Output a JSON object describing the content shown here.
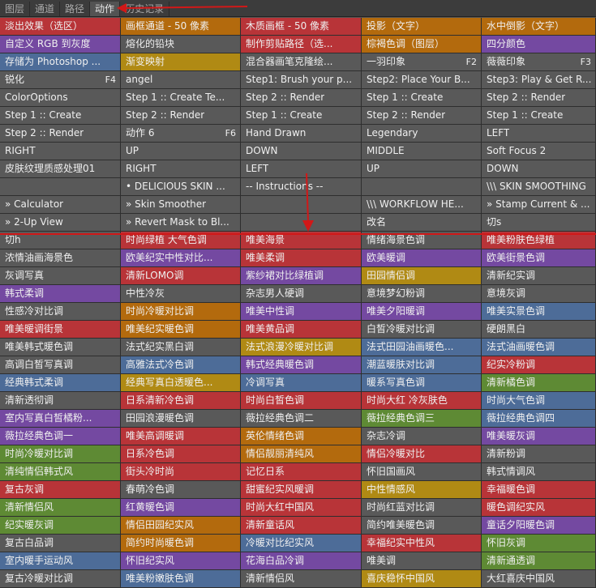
{
  "tabs": [
    {
      "label": "图层",
      "active": false
    },
    {
      "label": "通道",
      "active": false
    },
    {
      "label": "路径",
      "active": false
    },
    {
      "label": "动作",
      "active": true
    },
    {
      "label": "历史记录",
      "active": false
    }
  ],
  "palette": {
    "gray": "#595959",
    "orange": "#b36a0d",
    "purple": "#7449a1",
    "red": "#b83438",
    "gold": "#b08a14",
    "blue": "#4d6c98",
    "green": "#5e8a34"
  },
  "annotation_color": "#d11818",
  "rows": [
    [
      {
        "t": "淡出效果（选区）",
        "c": "red"
      },
      {
        "t": "画框通道 - 50 像素",
        "c": "orange"
      },
      {
        "t": "木质画框 - 50 像素",
        "c": "red"
      },
      {
        "t": "投影（文字）",
        "c": "orange"
      },
      {
        "t": "水中倒影（文字）",
        "c": "orange"
      }
    ],
    [
      {
        "t": "自定义 RGB 到灰度",
        "c": "purple"
      },
      {
        "t": "熔化的铅块",
        "c": "gray"
      },
      {
        "t": "制作剪贴路径（选...",
        "c": "red"
      },
      {
        "t": "棕褐色调（图层）",
        "c": "orange"
      },
      {
        "t": "四分颜色",
        "c": "purple"
      }
    ],
    [
      {
        "t": "存储为 Photoshop ...",
        "c": "blue"
      },
      {
        "t": "渐变映射",
        "c": "gold"
      },
      {
        "t": "混合器画笔克隆绘...",
        "c": "gray"
      },
      {
        "t": "一羽印象",
        "c": "gray",
        "k": "F2"
      },
      {
        "t": "薇薇印象",
        "c": "gray",
        "k": "F3"
      }
    ],
    [
      {
        "t": "锐化",
        "c": "gray",
        "k": "F4"
      },
      {
        "t": "angel",
        "c": "gray"
      },
      {
        "t": "Step1: Brush your p...",
        "c": "gray"
      },
      {
        "t": "Step2: Place Your B...",
        "c": "gray"
      },
      {
        "t": "Step3: Play & Get R...",
        "c": "gray"
      }
    ],
    [
      {
        "t": "ColorOptions",
        "c": "gray"
      },
      {
        "t": "Step 1 :: Create Te...",
        "c": "gray"
      },
      {
        "t": "Step 2 :: Render",
        "c": "gray"
      },
      {
        "t": "Step 1 :: Create",
        "c": "gray"
      },
      {
        "t": "Step 2 :: Render",
        "c": "gray"
      }
    ],
    [
      {
        "t": "Step 1 :: Create",
        "c": "gray"
      },
      {
        "t": "Step 2 :: Render",
        "c": "gray"
      },
      {
        "t": "Step 1 :: Create",
        "c": "gray"
      },
      {
        "t": "Step 2 :: Render",
        "c": "gray"
      },
      {
        "t": "Step 1 :: Create",
        "c": "gray"
      }
    ],
    [
      {
        "t": "Step 2 :: Render",
        "c": "gray"
      },
      {
        "t": "动作 6",
        "c": "gray",
        "k": "F6"
      },
      {
        "t": "Hand Drawn",
        "c": "gray"
      },
      {
        "t": "Legendary",
        "c": "gray"
      },
      {
        "t": "LEFT",
        "c": "gray"
      }
    ],
    [
      {
        "t": "RIGHT",
        "c": "gray"
      },
      {
        "t": "UP",
        "c": "gray"
      },
      {
        "t": "DOWN",
        "c": "gray"
      },
      {
        "t": "MIDDLE",
        "c": "gray"
      },
      {
        "t": "Soft Focus 2",
        "c": "gray"
      }
    ],
    [
      {
        "t": "皮肤纹理质感处理01",
        "c": "gray"
      },
      {
        "t": "RIGHT",
        "c": "gray"
      },
      {
        "t": "LEFT",
        "c": "gray"
      },
      {
        "t": "UP",
        "c": "gray"
      },
      {
        "t": "DOWN",
        "c": "gray"
      }
    ],
    [
      {
        "t": "",
        "c": "gray"
      },
      {
        "t": "• DELICIOUS SKIN ...",
        "c": "gray"
      },
      {
        "t": "-- Instructions --",
        "c": "gray"
      },
      {
        "t": "",
        "c": "gray"
      },
      {
        "t": "\\\\\\ SKIN SMOOTHING",
        "c": "gray"
      }
    ],
    [
      {
        "t": "» Calculator",
        "c": "gray"
      },
      {
        "t": "» Skin Smoother",
        "c": "gray"
      },
      {
        "t": "",
        "c": "gray"
      },
      {
        "t": "\\\\\\ WORKFLOW HE...",
        "c": "gray"
      },
      {
        "t": "» Stamp Current & ...",
        "c": "gray"
      }
    ],
    [
      {
        "t": "» 2-Up View",
        "c": "gray"
      },
      {
        "t": "» Revert Mask to Bl...",
        "c": "gray"
      },
      {
        "t": "",
        "c": "gray"
      },
      {
        "t": "改名",
        "c": "gray"
      },
      {
        "t": "切s",
        "c": "gray"
      }
    ],
    [
      {
        "t": "切h",
        "c": "gray"
      },
      {
        "t": "时尚绿植 大气色调",
        "c": "red"
      },
      {
        "t": "唯美海景",
        "c": "red"
      },
      {
        "t": "情绪海景色调",
        "c": "gray"
      },
      {
        "t": "唯美粉肤色绿植",
        "c": "red"
      }
    ],
    [
      {
        "t": "浓情油画海景色",
        "c": "gray"
      },
      {
        "t": "欧美纪实中性对比...",
        "c": "purple"
      },
      {
        "t": "唯美柔调",
        "c": "red"
      },
      {
        "t": "欧美暖调",
        "c": "purple"
      },
      {
        "t": "欧美街景色调",
        "c": "purple"
      }
    ],
    [
      {
        "t": "灰调写真",
        "c": "gray"
      },
      {
        "t": "清新LOMO调",
        "c": "red"
      },
      {
        "t": "紫纱裙对比绿植调",
        "c": "purple"
      },
      {
        "t": "田园情侣调",
        "c": "gold"
      },
      {
        "t": "清新纪实调",
        "c": "gray"
      }
    ],
    [
      {
        "t": "韩式柔调",
        "c": "purple"
      },
      {
        "t": "中性冷灰",
        "c": "gray"
      },
      {
        "t": "杂志男人硬调",
        "c": "gray"
      },
      {
        "t": "意境梦幻粉调",
        "c": "gray"
      },
      {
        "t": "意境灰调",
        "c": "gray"
      }
    ],
    [
      {
        "t": "性感冷对比调",
        "c": "gray"
      },
      {
        "t": "时尚冷暖对比调",
        "c": "orange"
      },
      {
        "t": "唯美中性调",
        "c": "purple"
      },
      {
        "t": "唯美夕阳暖调",
        "c": "purple"
      },
      {
        "t": "唯美实景色调",
        "c": "blue"
      }
    ],
    [
      {
        "t": "唯美暖调街景",
        "c": "red"
      },
      {
        "t": "唯美纪实暖色调",
        "c": "orange"
      },
      {
        "t": "唯美黄品调",
        "c": "red"
      },
      {
        "t": "白皙冷暖对比调",
        "c": "gray"
      },
      {
        "t": "硬朗黑白",
        "c": "gray"
      }
    ],
    [
      {
        "t": "唯美韩式暖色调",
        "c": "gray"
      },
      {
        "t": "法式纪实黑白调",
        "c": "gray"
      },
      {
        "t": "法式浪漫冷暖对比调",
        "c": "gold"
      },
      {
        "t": "法式田园油画暖色...",
        "c": "blue"
      },
      {
        "t": "法式油画暖色调",
        "c": "blue"
      }
    ],
    [
      {
        "t": "高调白皙写真调",
        "c": "gray"
      },
      {
        "t": "高雅法式冷色调",
        "c": "blue"
      },
      {
        "t": "韩式经典暖色调",
        "c": "purple"
      },
      {
        "t": "潮蓝暖肤对比调",
        "c": "blue"
      },
      {
        "t": "纪实冷粉调",
        "c": "red"
      }
    ],
    [
      {
        "t": "经典韩式柔调",
        "c": "blue"
      },
      {
        "t": "经典写真白透暖色...",
        "c": "gold"
      },
      {
        "t": "冷调写真",
        "c": "blue"
      },
      {
        "t": "暖系写真色调",
        "c": "blue"
      },
      {
        "t": "清新橘色调",
        "c": "green"
      }
    ],
    [
      {
        "t": "清新透彻调",
        "c": "gray"
      },
      {
        "t": "日系清新冷色调",
        "c": "red"
      },
      {
        "t": "时尚白皙色调",
        "c": "red"
      },
      {
        "t": "时尚大红 冷灰肤色",
        "c": "red"
      },
      {
        "t": "时尚大气色调",
        "c": "blue"
      }
    ],
    [
      {
        "t": "室内写真白皙橘粉...",
        "c": "purple"
      },
      {
        "t": "田园浪漫暖色调",
        "c": "gray"
      },
      {
        "t": "薇拉经典色调二",
        "c": "gray"
      },
      {
        "t": "薇拉经典色调三",
        "c": "green"
      },
      {
        "t": "薇拉经典色调四",
        "c": "blue"
      }
    ],
    [
      {
        "t": "薇拉经典色调一",
        "c": "purple"
      },
      {
        "t": "唯美高调暖调",
        "c": "red"
      },
      {
        "t": "英伦情绪色调",
        "c": "orange"
      },
      {
        "t": "杂志冷调",
        "c": "gray"
      },
      {
        "t": "唯美暖灰调",
        "c": "purple"
      }
    ],
    [
      {
        "t": "时尚冷暖对比调",
        "c": "green"
      },
      {
        "t": "日系冷色调",
        "c": "red"
      },
      {
        "t": "情侣靓丽清纯风",
        "c": "orange"
      },
      {
        "t": "情侣冷暖对比",
        "c": "red"
      },
      {
        "t": "清新粉调",
        "c": "gray"
      }
    ],
    [
      {
        "t": "清纯情侣韩式风",
        "c": "green"
      },
      {
        "t": "街头冷时尚",
        "c": "red"
      },
      {
        "t": "记忆日系",
        "c": "red"
      },
      {
        "t": "怀旧国画风",
        "c": "gray"
      },
      {
        "t": "韩式情调风",
        "c": "gray"
      }
    ],
    [
      {
        "t": "复古灰调",
        "c": "red"
      },
      {
        "t": "春萌冷色调",
        "c": "gray"
      },
      {
        "t": "甜蜜纪实风暖调",
        "c": "red"
      },
      {
        "t": "中性情感风",
        "c": "gold"
      },
      {
        "t": "幸福暖色调",
        "c": "red"
      }
    ],
    [
      {
        "t": "清新情侣风",
        "c": "green"
      },
      {
        "t": "红黄暖色调",
        "c": "purple"
      },
      {
        "t": "时尚大红中国风",
        "c": "red"
      },
      {
        "t": "时尚红蓝对比调",
        "c": "gray"
      },
      {
        "t": "暖色调纪实风",
        "c": "red"
      }
    ],
    [
      {
        "t": "纪实暖灰调",
        "c": "green"
      },
      {
        "t": "情侣田园纪实风",
        "c": "orange"
      },
      {
        "t": "清新童话风",
        "c": "red"
      },
      {
        "t": "简约唯美暖色调",
        "c": "gray"
      },
      {
        "t": "童话夕阳暖色调",
        "c": "purple"
      }
    ],
    [
      {
        "t": "复古白品调",
        "c": "gray"
      },
      {
        "t": "简约时尚暖色调",
        "c": "orange"
      },
      {
        "t": "冷暖对比纪实风",
        "c": "blue"
      },
      {
        "t": "幸福纪实中性风",
        "c": "red"
      },
      {
        "t": "怀旧灰调",
        "c": "green"
      }
    ],
    [
      {
        "t": "室内暖手运动风",
        "c": "blue"
      },
      {
        "t": "怀旧纪实风",
        "c": "purple"
      },
      {
        "t": "花海白品冷调",
        "c": "purple"
      },
      {
        "t": "唯美调",
        "c": "gray"
      },
      {
        "t": "清新通透调",
        "c": "green"
      }
    ],
    [
      {
        "t": "复古冷暖对比调",
        "c": "gray"
      },
      {
        "t": "唯美粉嫩肤色调",
        "c": "blue"
      },
      {
        "t": "清新情侣风",
        "c": "gray"
      },
      {
        "t": "喜庆稳怀中国风",
        "c": "gold"
      },
      {
        "t": "大红喜庆中国风",
        "c": "gray"
      }
    ]
  ]
}
